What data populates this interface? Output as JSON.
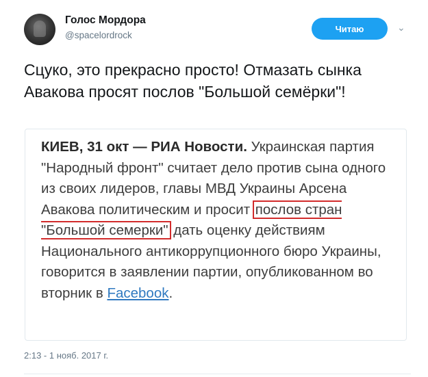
{
  "user": {
    "name": "Голос Мордора",
    "handle": "@spacelordrock",
    "follow_label": "Читаю"
  },
  "tweet": {
    "text": "Сцуко, это прекрасно просто! Отмазать сынка Авакова просят послов \"Большой семёрки\"!",
    "timestamp": "2:13 - 1 нояб. 2017 г."
  },
  "card": {
    "lead": "КИЕВ, 31 окт — РИА Новости.",
    "text_before": " Украинская партия \"Народный фронт\" считает дело против сына одного из своих лидеров, главы МВД Украины Арсена Авакова политическим и просит ",
    "highlight": "послов стран \"Большой семерки\"",
    "text_after": " дать оценку действиям Национального антикоррупционного бюро Украины, говорится в заявлении партии, опубликованном во вторник в ",
    "link": "Facebook",
    "end": "."
  },
  "colors": {
    "accent": "#1da1f2",
    "highlight_border": "#d22b2b",
    "link": "#2f79c0"
  },
  "icons": {
    "more": "chevron-down-icon"
  }
}
